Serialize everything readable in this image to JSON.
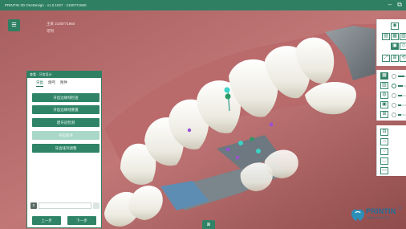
{
  "window": {
    "title": "PRINTIN 3D OneDesign · v1.0.1027 · 2100771660",
    "minimize_symbol": "–",
    "restore_symbol": "⧉"
  },
  "patient": {
    "name": "王某 2100771660",
    "subtitle": "牙列"
  },
  "menu": {
    "icon": "hamburger-icon"
  },
  "panel": {
    "title": "查看 · 牙齿设计",
    "tabs": [
      {
        "label": "牙齿",
        "active": true
      },
      {
        "label": "颌弓",
        "active": false
      },
      {
        "label": "附件",
        "active": false
      }
    ],
    "buttons": [
      {
        "label": "牙齿边缘线检查",
        "enabled": true
      },
      {
        "label": "牙齿边缘线重置",
        "enabled": true
      },
      {
        "label": "建牙冠检测",
        "enabled": true
      },
      {
        "label": "牙齿排序",
        "enabled": false
      },
      {
        "label": "牙齿排列调整",
        "enabled": true
      }
    ],
    "search_icon": "search-icon",
    "prev_label": "上一步",
    "next_label": "下一步"
  },
  "toolbar": {
    "sliders": [
      {
        "name": "opacity-1",
        "value": 0.75
      },
      {
        "name": "opacity-2",
        "value": 0.6
      },
      {
        "name": "opacity-3",
        "value": 0.5
      },
      {
        "name": "opacity-4",
        "value": 0.4
      },
      {
        "name": "opacity-5",
        "value": 0.35
      }
    ]
  },
  "view_button_icon": "3d-view-icon",
  "logo": {
    "wordmark": "PRINTIN",
    "tagline": "Digital Dental 3D",
    "suffix": "3"
  },
  "colors": {
    "brand": "#2f7f63",
    "gum": "#b36a6a",
    "tooth": "#f3f1e9",
    "marker_cyan": "#3ad3c6",
    "marker_purple": "#9a4fd4"
  }
}
